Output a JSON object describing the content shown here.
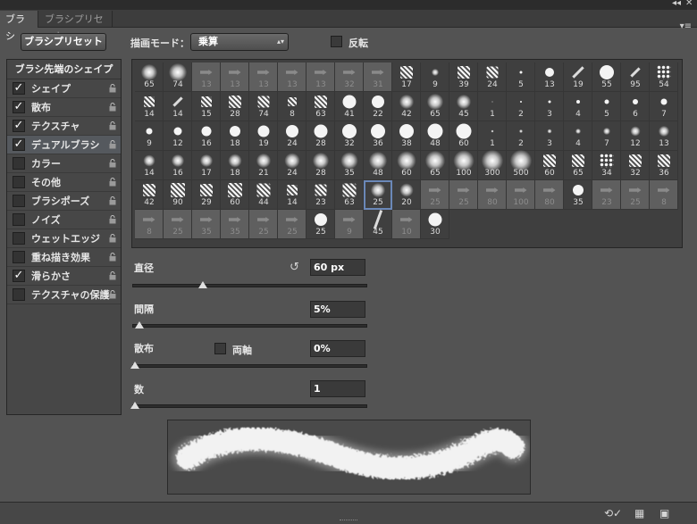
{
  "window": {
    "collapse_icon": "double-chevron-right-icon",
    "close_icon": "close-icon",
    "collapse_glyph": "◂◂",
    "close_glyph": "✕"
  },
  "tabs": [
    {
      "label": "ブラシ",
      "active": true
    },
    {
      "label": "ブラシプリセット",
      "active": false
    }
  ],
  "panel_menu_glyph": "▾≡",
  "preset_button": {
    "label": "ブラシプリセット"
  },
  "blend_mode": {
    "label": "描画モード：",
    "value": "乗算",
    "arrow": "▴▾"
  },
  "flip": {
    "label": "反転",
    "checked": false
  },
  "left_panel": {
    "header": "ブラシ先端のシェイプ",
    "items": [
      {
        "label": "シェイプ",
        "checked": true,
        "selected": false
      },
      {
        "label": "散布",
        "checked": true,
        "selected": false
      },
      {
        "label": "テクスチャ",
        "checked": true,
        "selected": false
      },
      {
        "label": "デュアルブラシ",
        "checked": true,
        "selected": true
      },
      {
        "label": "カラー",
        "checked": false,
        "selected": false
      },
      {
        "label": "その他",
        "checked": false,
        "selected": false
      },
      {
        "label": "ブラシポーズ",
        "checked": false,
        "selected": false
      },
      {
        "label": "ノイズ",
        "checked": false,
        "selected": false
      },
      {
        "label": "ウェットエッジ",
        "checked": false,
        "selected": false
      },
      {
        "label": "重ね描き効果",
        "checked": false,
        "selected": false
      },
      {
        "label": "滑らかさ",
        "checked": true,
        "selected": false
      },
      {
        "label": "テクスチャの保護",
        "checked": false,
        "selected": false
      }
    ]
  },
  "brush_grid": {
    "selected_index": 84,
    "tips": [
      {
        "n": "65",
        "t": "soft",
        "s": 18
      },
      {
        "n": "74",
        "t": "soft",
        "s": 20
      },
      {
        "n": "13",
        "t": "arrow",
        "d": 1
      },
      {
        "n": "13",
        "t": "arrow",
        "d": 1
      },
      {
        "n": "13",
        "t": "arrow",
        "d": 1
      },
      {
        "n": "13",
        "t": "arrow",
        "d": 1
      },
      {
        "n": "13",
        "t": "arrow",
        "d": 1
      },
      {
        "n": "32",
        "t": "arrow",
        "d": 1
      },
      {
        "n": "31",
        "t": "arrow",
        "d": 1
      },
      {
        "n": "17",
        "t": "tex",
        "s": 14
      },
      {
        "n": "9",
        "t": "soft",
        "s": 8
      },
      {
        "n": "39",
        "t": "tex",
        "s": 14
      },
      {
        "n": "24",
        "t": "tex",
        "s": 13
      },
      {
        "n": "5",
        "t": "hard",
        "s": 3
      },
      {
        "n": "13",
        "t": "hard",
        "s": 10
      },
      {
        "n": "19",
        "t": "line",
        "s": 4
      },
      {
        "n": "55",
        "t": "hard",
        "s": 16
      },
      {
        "n": "95",
        "t": "line",
        "s": 3
      },
      {
        "n": "54",
        "t": "dotted",
        "s": 16
      },
      {
        "n": "14",
        "t": "tex",
        "s": 12
      },
      {
        "n": "14",
        "t": "line",
        "s": 3
      },
      {
        "n": "15",
        "t": "tex",
        "s": 12
      },
      {
        "n": "28",
        "t": "tex",
        "s": 14
      },
      {
        "n": "74",
        "t": "tex",
        "s": 13
      },
      {
        "n": "8",
        "t": "tex",
        "s": 10
      },
      {
        "n": "63",
        "t": "tex",
        "s": 14
      },
      {
        "n": "41",
        "t": "hard",
        "s": 15
      },
      {
        "n": "22",
        "t": "hard",
        "s": 14
      },
      {
        "n": "42",
        "t": "soft",
        "s": 16
      },
      {
        "n": "65",
        "t": "soft",
        "s": 18
      },
      {
        "n": "45",
        "t": "soft",
        "s": 16
      },
      {
        "n": "1",
        "t": "hard",
        "s": 1
      },
      {
        "n": "2",
        "t": "hard",
        "s": 2
      },
      {
        "n": "3",
        "t": "hard",
        "s": 3
      },
      {
        "n": "4",
        "t": "hard",
        "s": 4
      },
      {
        "n": "5",
        "t": "hard",
        "s": 5
      },
      {
        "n": "6",
        "t": "hard",
        "s": 6
      },
      {
        "n": "7",
        "t": "hard",
        "s": 7
      },
      {
        "n": "9",
        "t": "hard",
        "s": 7
      },
      {
        "n": "12",
        "t": "hard",
        "s": 9
      },
      {
        "n": "16",
        "t": "hard",
        "s": 11
      },
      {
        "n": "18",
        "t": "hard",
        "s": 12
      },
      {
        "n": "19",
        "t": "hard",
        "s": 13
      },
      {
        "n": "24",
        "t": "hard",
        "s": 14
      },
      {
        "n": "28",
        "t": "hard",
        "s": 15
      },
      {
        "n": "32",
        "t": "hard",
        "s": 16
      },
      {
        "n": "36",
        "t": "hard",
        "s": 16
      },
      {
        "n": "38",
        "t": "hard",
        "s": 16
      },
      {
        "n": "48",
        "t": "hard",
        "s": 17
      },
      {
        "n": "60",
        "t": "hard",
        "s": 17
      },
      {
        "n": "1",
        "t": "soft",
        "s": 3
      },
      {
        "n": "2",
        "t": "soft",
        "s": 4
      },
      {
        "n": "3",
        "t": "soft",
        "s": 5
      },
      {
        "n": "4",
        "t": "soft",
        "s": 6
      },
      {
        "n": "7",
        "t": "soft",
        "s": 8
      },
      {
        "n": "12",
        "t": "soft",
        "s": 11
      },
      {
        "n": "13",
        "t": "soft",
        "s": 12
      },
      {
        "n": "14",
        "t": "soft",
        "s": 13
      },
      {
        "n": "16",
        "t": "soft",
        "s": 14
      },
      {
        "n": "17",
        "t": "soft",
        "s": 14
      },
      {
        "n": "18",
        "t": "soft",
        "s": 15
      },
      {
        "n": "21",
        "t": "soft",
        "s": 16
      },
      {
        "n": "24",
        "t": "soft",
        "s": 17
      },
      {
        "n": "28",
        "t": "soft",
        "s": 18
      },
      {
        "n": "35",
        "t": "soft",
        "s": 19
      },
      {
        "n": "48",
        "t": "soft",
        "s": 20
      },
      {
        "n": "60",
        "t": "soft",
        "s": 21
      },
      {
        "n": "65",
        "t": "soft",
        "s": 22
      },
      {
        "n": "100",
        "t": "soft",
        "s": 23
      },
      {
        "n": "300",
        "t": "soft",
        "s": 24
      },
      {
        "n": "500",
        "t": "soft",
        "s": 24
      },
      {
        "n": "60",
        "t": "tex",
        "s": 14
      },
      {
        "n": "65",
        "t": "tex",
        "s": 14
      },
      {
        "n": "34",
        "t": "dotted",
        "s": 16
      },
      {
        "n": "32",
        "t": "tex",
        "s": 14
      },
      {
        "n": "36",
        "t": "tex",
        "s": 14
      },
      {
        "n": "42",
        "t": "tex",
        "s": 14
      },
      {
        "n": "90",
        "t": "tex",
        "s": 16
      },
      {
        "n": "29",
        "t": "tex",
        "s": 14
      },
      {
        "n": "60",
        "t": "tex",
        "s": 16
      },
      {
        "n": "44",
        "t": "tex",
        "s": 15
      },
      {
        "n": "14",
        "t": "tex",
        "s": 12
      },
      {
        "n": "23",
        "t": "tex",
        "s": 13
      },
      {
        "n": "63",
        "t": "tex",
        "s": 15
      },
      {
        "n": "25",
        "t": "soft",
        "s": 16
      },
      {
        "n": "20",
        "t": "soft",
        "s": 15
      },
      {
        "n": "25",
        "t": "arrow",
        "d": 1
      },
      {
        "n": "25",
        "t": "arrow",
        "d": 1
      },
      {
        "n": "80",
        "t": "arrow",
        "d": 1
      },
      {
        "n": "100",
        "t": "arrow",
        "d": 1
      },
      {
        "n": "80",
        "t": "arrow",
        "d": 1
      },
      {
        "n": "35",
        "t": "hard",
        "s": 12
      },
      {
        "n": "23",
        "t": "arrow",
        "d": 1
      },
      {
        "n": "25",
        "t": "arrow",
        "d": 1
      },
      {
        "n": "8",
        "t": "arrow",
        "d": 1
      },
      {
        "n": "8",
        "t": "arrow",
        "d": 1
      },
      {
        "n": "25",
        "t": "arrow",
        "d": 1
      },
      {
        "n": "35",
        "t": "arrow",
        "d": 1
      },
      {
        "n": "35",
        "t": "arrow",
        "d": 1
      },
      {
        "n": "25",
        "t": "arrow",
        "d": 1
      },
      {
        "n": "25",
        "t": "arrow",
        "d": 1
      },
      {
        "n": "25",
        "t": "hard",
        "s": 14
      },
      {
        "n": "9",
        "t": "arrow",
        "d": 1
      },
      {
        "n": "45",
        "t": "line",
        "s": 6
      },
      {
        "n": "10",
        "t": "arrow",
        "d": 1
      },
      {
        "n": "30",
        "t": "hard",
        "s": 15
      }
    ]
  },
  "settings": {
    "diameter": {
      "label": "直径",
      "value": "60 px",
      "slider_fraction": 0.29
    },
    "spacing": {
      "label": "間隔",
      "value": "5%",
      "slider_fraction": 0.02
    },
    "scatter": {
      "label": "散布",
      "value": "0%",
      "slider_fraction": 0.0,
      "both_axes_label": "両軸",
      "both_axes_checked": false
    },
    "count": {
      "label": "数",
      "value": "1",
      "slider_fraction": 0.0
    }
  },
  "reset_icon_glyph": "↺",
  "status_bar": {
    "icons": [
      "toggle-preview-icon",
      "create-brush-icon",
      "new-preset-icon"
    ],
    "glyphs": [
      "⟲✓",
      "▦",
      "▣"
    ]
  }
}
